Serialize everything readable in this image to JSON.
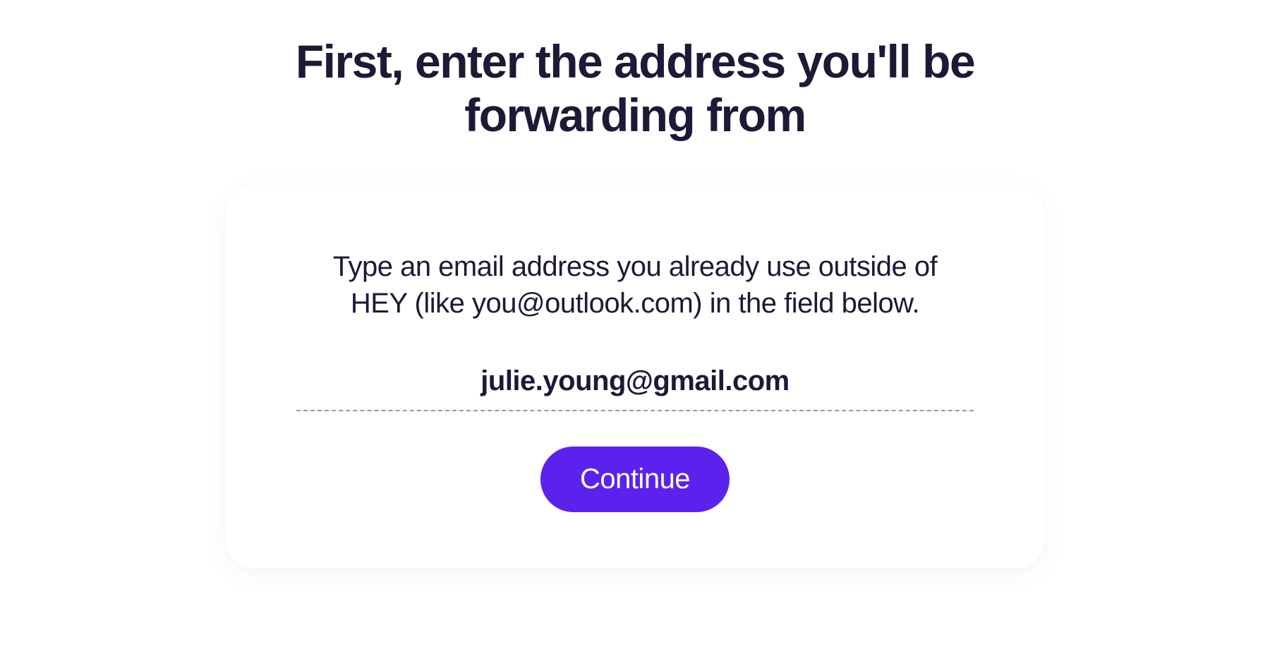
{
  "header": {
    "title": "First, enter the address you'll be forwarding from"
  },
  "card": {
    "instruction": "Type an email address you already use outside of HEY (like you@outlook.com) in the field below.",
    "email_value": "julie.young@gmail.com",
    "email_placeholder": "",
    "continue_label": "Continue"
  },
  "colors": {
    "text_primary": "#1d1936",
    "accent": "#5b22ee",
    "border_dashed": "#9a98a6"
  }
}
